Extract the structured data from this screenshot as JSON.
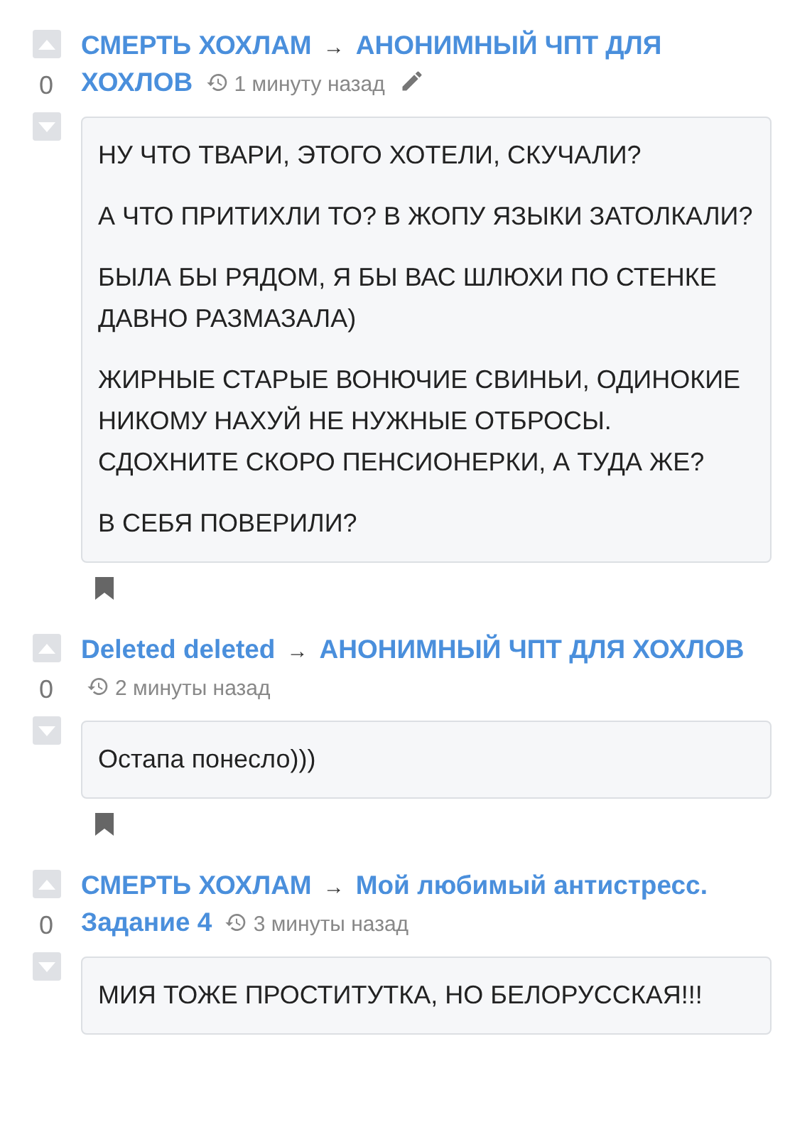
{
  "comments": [
    {
      "score": "0",
      "author": "СМЕРТЬ ХОХЛАМ",
      "arrow": "→",
      "target": [
        "АНОНИМНЫЙ ЧПТ ДЛЯ",
        "ХОХЛОВ"
      ],
      "time": "1 минуту назад",
      "editable": true,
      "bookmark": true,
      "paragraphs": [
        "НУ ЧТО ТВАРИ, ЭТОГО ХОТЕЛИ, СКУЧАЛИ?",
        "А ЧТО ПРИТИХЛИ ТО? В ЖОПУ ЯЗЫКИ ЗАТОЛКАЛИ?",
        "БЫЛА БЫ РЯДОМ, Я БЫ ВАС ШЛЮХИ ПО СТЕНКЕ ДАВНО РАЗМАЗАЛА)",
        "ЖИРНЫЕ СТАРЫЕ ВОНЮЧИЕ СВИНЬИ, ОДИНОКИЕ НИКОМУ НАХУЙ НЕ НУЖНЫЕ ОТБРОСЫ. СДОХНИТЕ СКОРО ПЕНСИОНЕРКИ, А ТУДА ЖЕ?",
        "В СЕБЯ ПОВЕРИЛИ?"
      ]
    },
    {
      "score": "0",
      "author": "Deleted deleted",
      "arrow": "→",
      "target": [
        "АНОНИМНЫЙ ЧПТ ДЛЯ ХОХЛОВ"
      ],
      "time": "2 минуты назад",
      "editable": false,
      "bookmark": true,
      "paragraphs": [
        "Остапа понесло)))"
      ]
    },
    {
      "score": "0",
      "author": "СМЕРТЬ ХОХЛАМ",
      "arrow": "→",
      "target": [
        "Мой любимый антистресс.",
        "Задание 4"
      ],
      "time": "3 минуты назад",
      "editable": false,
      "bookmark": false,
      "paragraphs": [
        "МИЯ ТОЖЕ ПРОСТИТУТКА, НО БЕЛОРУССКАЯ!!!"
      ]
    }
  ]
}
